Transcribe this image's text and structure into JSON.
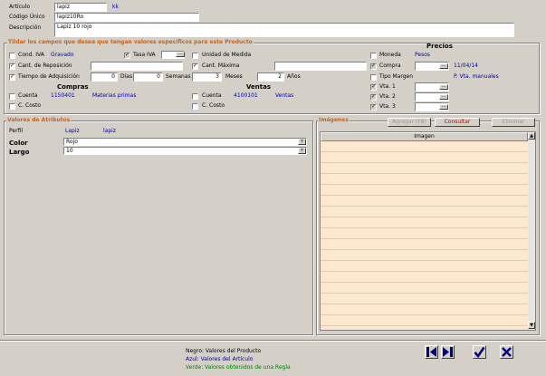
{
  "header": {
    "articulo_label": "Artículo",
    "articulo_value": "lapiz",
    "articulo_suffix": "kk",
    "codigo_label": "Código Único",
    "codigo_value": "lapiz10Ro",
    "descripcion_label": "Descripción",
    "descripcion_value": "Lapiz 10 rojo"
  },
  "campos": {
    "title": "Tildar los campos que desea que tengan valores específicos para este Producto",
    "cond_iva": {
      "label": "Cond. IVA",
      "value": "Gravado",
      "checked": false
    },
    "tasa_iva": {
      "label": "Tasa IVA",
      "checked": true
    },
    "unidad_medida": {
      "label": "Unidad de Medida",
      "checked": false
    },
    "cant_reposicion": {
      "label": "Cant. de Reposición",
      "checked": true
    },
    "cant_maxima": {
      "label": "Cant. Máxima",
      "checked": true
    },
    "tiempo_adq": {
      "label": "Tiempo de Adquisición",
      "checked": true,
      "dias_value": "0",
      "dias_label": "Días",
      "semanas_value": "0",
      "semanas_label": "Semanas",
      "meses_value": "3",
      "meses_label": "Meses",
      "anios_value": "2",
      "anios_label": "Años"
    },
    "compras": {
      "title": "Compras",
      "cuenta_label": "Cuenta",
      "cuenta_code": "1150401",
      "cuenta_name": "Materias primas",
      "ccosto_label": "C. Costo"
    },
    "ventas": {
      "title": "Ventas",
      "cuenta_label": "Cuenta",
      "cuenta_code": "4100101",
      "cuenta_name": "Ventas",
      "ccosto_label": "C. Costo"
    },
    "precios": {
      "title": "Precios",
      "moneda_label": "Moneda",
      "moneda_value": "Pesos",
      "compra_label": "Compra",
      "compra_date": "11/04/14",
      "tipo_margen_label": "Tipo Margen",
      "tipo_margen_value": "P. Vta. manuales",
      "vta1_label": "Vta. 1",
      "vta2_label": "Vta. 2",
      "vta3_label": "Vta. 3"
    }
  },
  "atributos": {
    "title": "Valores de Atributos",
    "perfil_label": "Perfil",
    "perfil_value1": "Lapiz",
    "perfil_value2": "lapiz",
    "rows": [
      {
        "label": "Color",
        "value": "Rojo"
      },
      {
        "label": "Largo",
        "value": "10"
      }
    ]
  },
  "imagenes": {
    "title": "Imágenes",
    "agregar_label": "Agregar (F8)",
    "consultar_label": "Consultar",
    "eliminar_label": "Eliminar",
    "column_header": "Imagen"
  },
  "legend": {
    "negro": "Negro: Valores del Producto",
    "azul": "Azul: Valores del Artículo",
    "verde": "Verde: Valores obtenidos de una Regla"
  },
  "colors": {
    "background": "#d4d0c8",
    "group_title": "#d06010",
    "value_blue": "#0000a0",
    "legend_green": "#008000",
    "grid_row": "#fde8cf"
  },
  "icons": {
    "nav_prev": "arrow-left-icon",
    "nav_next": "arrow-right-icon",
    "accept": "checkmark-icon",
    "cancel": "close-x-icon"
  }
}
